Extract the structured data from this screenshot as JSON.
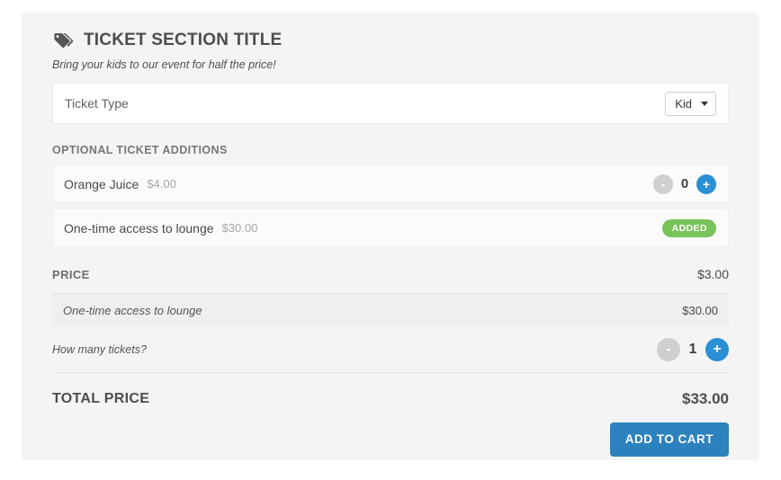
{
  "section": {
    "icon": "tags-icon",
    "title": "TICKET SECTION TITLE",
    "subtitle": "Bring your kids to our event for half the price!"
  },
  "ticket_type": {
    "label": "Ticket Type",
    "selected": "Kid",
    "caret_icon": "chevron-down-icon"
  },
  "additions": {
    "heading": "OPTIONAL TICKET ADDITIONS",
    "items": [
      {
        "name": "Orange Juice",
        "price": "$4.00",
        "quantity": "0",
        "minus_label": "-",
        "plus_label": "+",
        "state": "stepper"
      },
      {
        "name": "One-time access to lounge",
        "price": "$30.00",
        "badge": "ADDED",
        "state": "added"
      }
    ]
  },
  "price": {
    "label": "PRICE",
    "value": "$3.00",
    "line_items": [
      {
        "name": "One-time access to lounge",
        "value": "$30.00"
      }
    ]
  },
  "quantity": {
    "label": "How many tickets?",
    "value": "1",
    "minus_label": "-",
    "plus_label": "+"
  },
  "total": {
    "label": "TOTAL PRICE",
    "value": "$33.00"
  },
  "actions": {
    "add_to_cart": "ADD TO CART"
  },
  "colors": {
    "accent_blue": "#2a8fd4",
    "button_blue": "#2d82be",
    "badge_green": "#79c35a",
    "disabled_gray": "#cfcfcf",
    "panel_bg": "#f4f4f4"
  }
}
